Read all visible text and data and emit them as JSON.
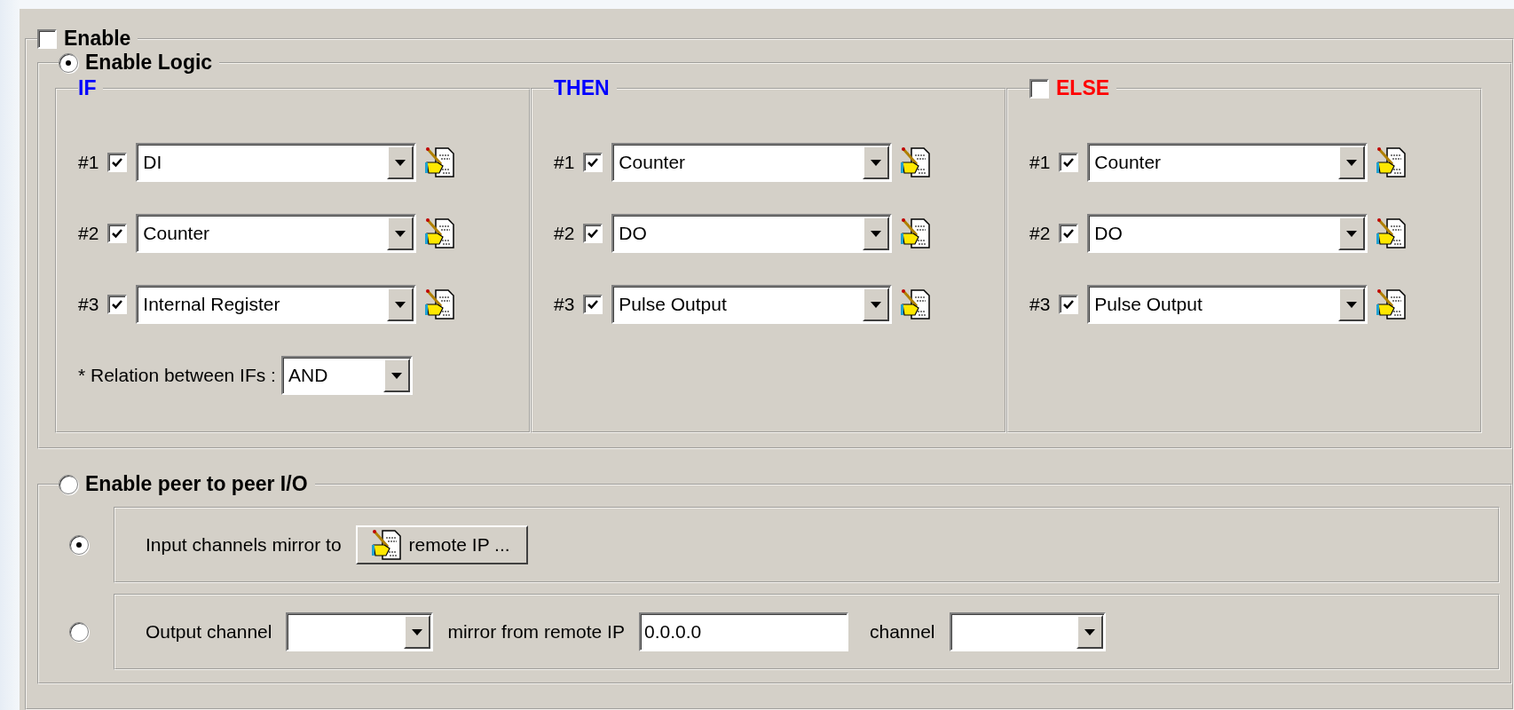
{
  "enable": {
    "label": "Enable",
    "checked": false
  },
  "logic": {
    "label": "Enable Logic",
    "selected": true,
    "columns": [
      {
        "title": "IF",
        "color": "#0000ff",
        "rows": [
          {
            "number": "#1",
            "checked": true,
            "value": "DI"
          },
          {
            "number": "#2",
            "checked": true,
            "value": "Counter"
          },
          {
            "number": "#3",
            "checked": true,
            "value": "Internal Register"
          }
        ],
        "relation": {
          "label": "* Relation between IFs :",
          "value": "AND"
        }
      },
      {
        "title": "THEN",
        "color": "#0000ff",
        "rows": [
          {
            "number": "#1",
            "checked": true,
            "value": "Counter"
          },
          {
            "number": "#2",
            "checked": true,
            "value": "DO"
          },
          {
            "number": "#3",
            "checked": true,
            "value": "Pulse Output"
          }
        ]
      },
      {
        "title": "ELSE",
        "color": "#ff0000",
        "checked": false,
        "rows": [
          {
            "number": "#1",
            "checked": true,
            "value": "Counter"
          },
          {
            "number": "#2",
            "checked": true,
            "value": "DO"
          },
          {
            "number": "#3",
            "checked": true,
            "value": "Pulse Output"
          }
        ]
      }
    ]
  },
  "peer": {
    "label": "Enable peer to peer I/O",
    "selected": false,
    "input_mirror": {
      "selected": true,
      "label": "Input channels mirror to",
      "button": "remote IP ..."
    },
    "output_mirror": {
      "selected": false,
      "output_label": "Output channel",
      "mirror_label": "mirror from remote IP",
      "ip": "0.0.0.0",
      "channel_label": "channel"
    }
  }
}
